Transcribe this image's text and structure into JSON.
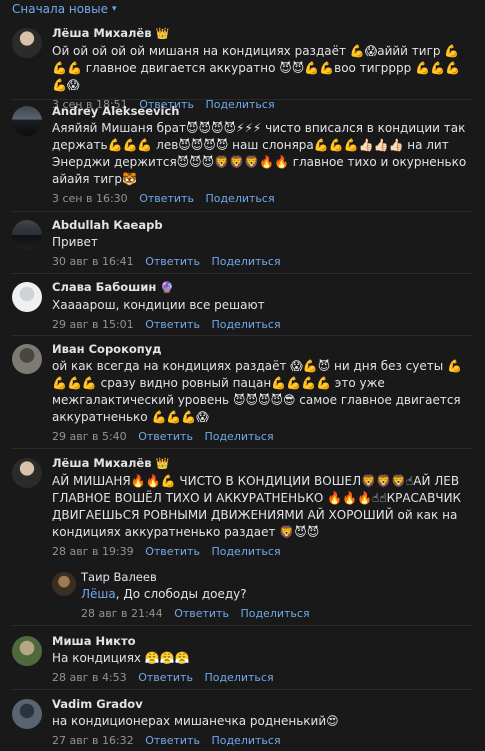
{
  "sort": {
    "label": "Сначала новые"
  },
  "comments": [
    {
      "author": "Лёша Михалёв",
      "badge": "👑",
      "text": "Ой ой ой ой ой мишаня на кондициях раздаёт 💪😱аййй тигр 💪💪💪 главное двигается аккуратно 😈😈💪💪воо тигрррр 💪💪💪💪😱",
      "date": "3 сен в 18:51",
      "reply": "Ответить",
      "share": "Поделиться"
    },
    {
      "author": "Andrey Alekseevich",
      "badge": "",
      "text": "Аяяйяй Мишаня брат😈😈😈😈⚡⚡⚡ чисто вписался в кондиции так держать💪💪💪 лев😈😈😈😈 наш слоняра💪💪💪👍🏻👍🏻👍🏻 на лит Энерджи держится😈😈😈🦁🦁🦁🔥🔥 главное тихо и окурненько айайя тигр🐯",
      "date": "3 сен в 16:30",
      "reply": "Ответить",
      "share": "Поделиться"
    },
    {
      "author": "Abdullah Каеарb",
      "badge": "",
      "text": "Привет",
      "date": "30 авг в 16:41",
      "reply": "Ответить",
      "share": "Поделиться"
    },
    {
      "author": "Слава Бабошин",
      "badge": "🔮",
      "text": "Хаааарош, кондиции все решают",
      "date": "29 авг в 15:01",
      "reply": "Ответить",
      "share": "Поделиться"
    },
    {
      "author": "Иван Сорокопуд",
      "badge": "",
      "text": "ой как всегда на кондициях раздаёт 😱💪😈 ни дня без суеты 💪💪💪💪 сразу видно ровный пацан💪💪💪💪 это уже межгалактический уровень 😈😈😈😈😎 самое главное двигается аккуратненько 💪💪💪😱",
      "date": "29 авг в 5:40",
      "reply": "Ответить",
      "share": "Поделиться"
    },
    {
      "author": "Лёша Михалёв",
      "badge": "👑",
      "text": "АЙ МИШАНЯ🔥🔥💪 ЧИСТО В КОНДИЦИИ ВОШЕЛ🦁🦁🦁☝АЙ ЛЕВ ГЛАВНОЕ ВОШЁЛ ТИХО И АККУРАТНЕНЬКО 🔥🔥🔥☝☝КРАСАВЧИК ДВИГАЕШЬСЯ РОВНЫМИ ДВИЖЕНИЯМИ АЙ ХОРОШИЙ ой как на кондициях аккуратненько раздает 🦁😈😈",
      "date": "28 авг в 19:39",
      "reply": "Ответить",
      "share": "Поделиться"
    },
    {
      "author": "Таир Валеев",
      "badge": "",
      "mention": "Лёша",
      "text": ", До слободы доеду?",
      "date": "28 авг в 21:44",
      "reply": "Ответить",
      "share": "Поделиться"
    },
    {
      "author": "Миша Никто",
      "badge": "",
      "text": "На кондициях 😤😤😤",
      "date": "28 авг в 4:53",
      "reply": "Ответить",
      "share": "Поделиться"
    },
    {
      "author": "Vadim Gradov",
      "badge": "",
      "text": "на кондиционерах мишанечка родненький😍",
      "date": "27 авг в 16:32",
      "reply": "Ответить",
      "share": "Поделиться"
    }
  ]
}
